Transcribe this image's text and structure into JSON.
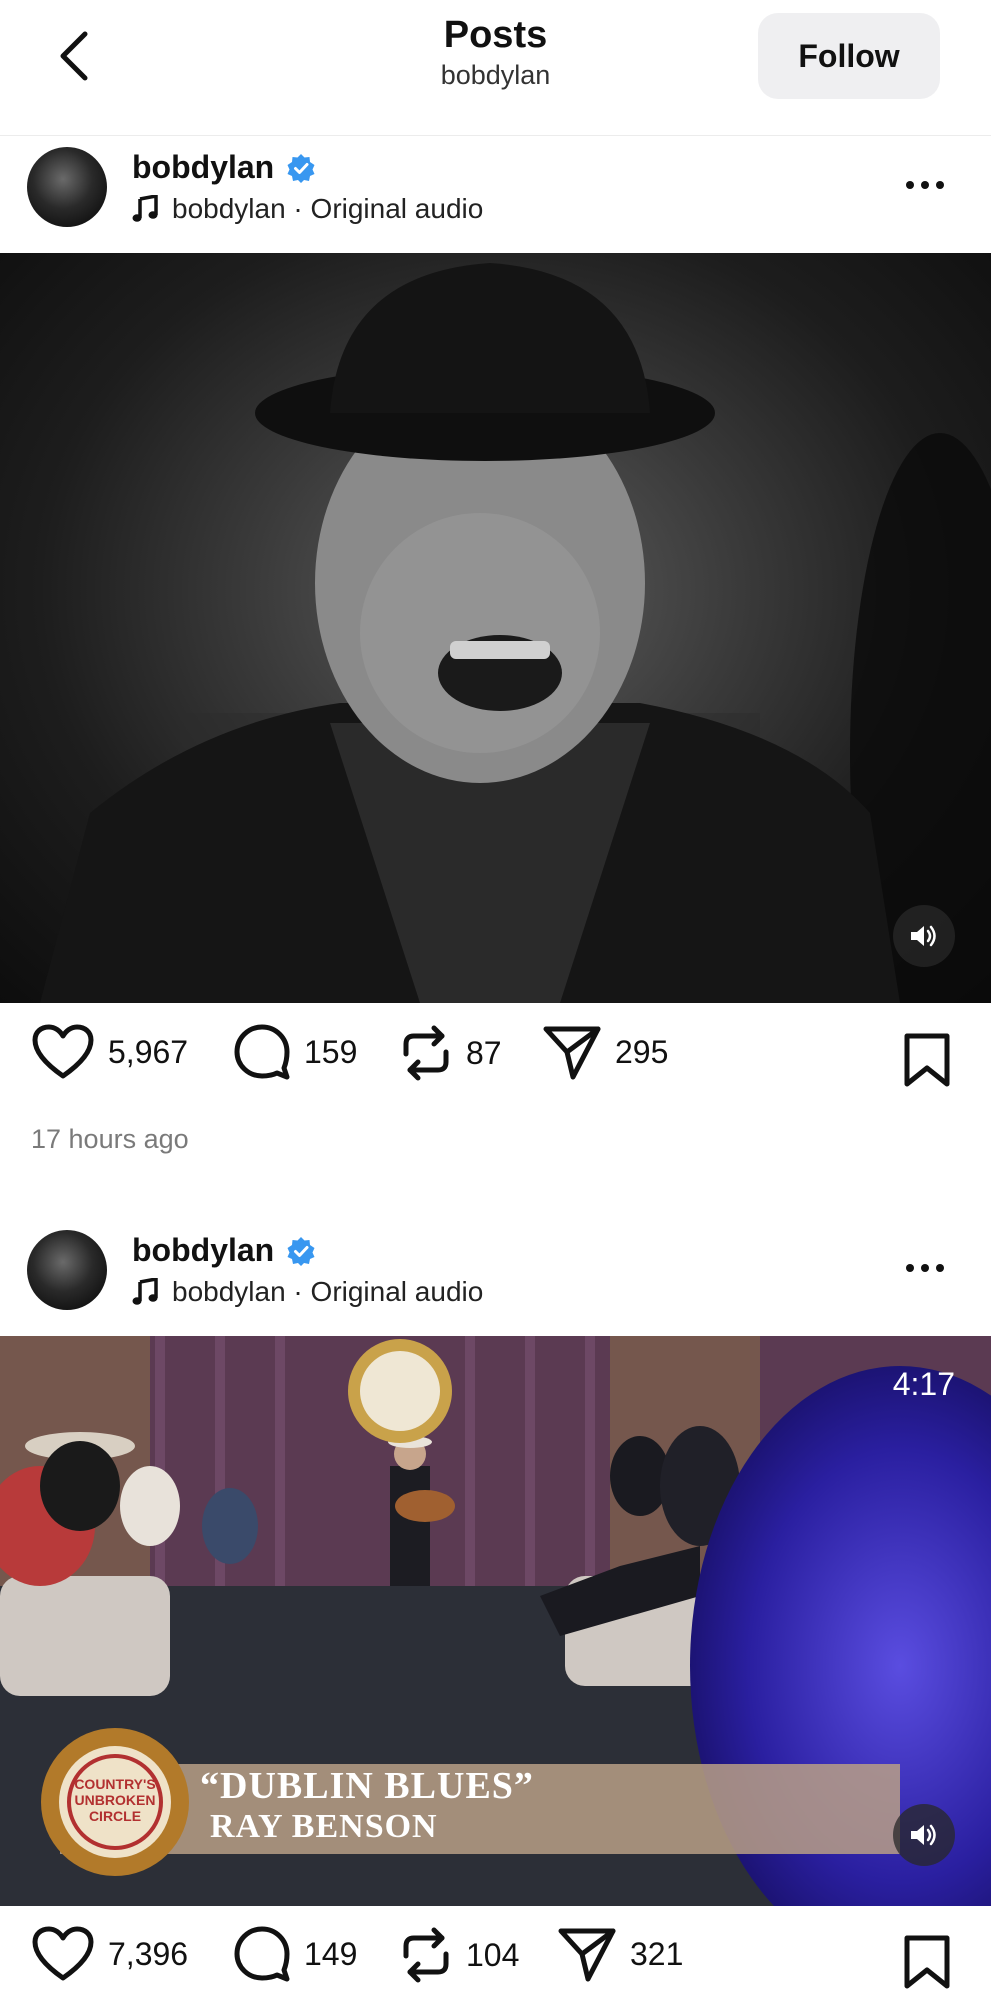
{
  "header": {
    "title": "Posts",
    "subtitle": "bobdylan",
    "follow_label": "Follow"
  },
  "posts": [
    {
      "username": "bobdylan",
      "audio": "bobdylan · Original audio",
      "media_description": "black-and-white film still of a laughing man in a fedora and leather jacket",
      "likes": "5,967",
      "comments": "159",
      "reposts": "87",
      "shares": "295",
      "time": "17 hours ago"
    },
    {
      "username": "bobdylan",
      "audio": "bobdylan · Original audio",
      "media_description": "TV stage performance with a seated audience and a guitarist",
      "duration": "4:17",
      "badge_text": "COUNTRY'S UNBROKEN CIRCLE",
      "caption_line1": "“DUBLIN BLUES”",
      "caption_line2": "RAY BENSON",
      "likes": "7,396",
      "comments": "149",
      "reposts": "104",
      "shares": "321"
    }
  ],
  "icons": {
    "back": "chevron-left-icon",
    "verified": "verified-badge-icon",
    "audio": "music-note-icon",
    "more": "more-horizontal-icon",
    "like": "heart-icon",
    "comment": "comment-icon",
    "repost": "repost-icon",
    "share": "send-icon",
    "save": "bookmark-icon",
    "mute": "speaker-icon"
  },
  "colors": {
    "verified_blue": "#3897f0",
    "follow_bg": "#efeff1",
    "timestamp_gray": "#7a7a7a"
  }
}
